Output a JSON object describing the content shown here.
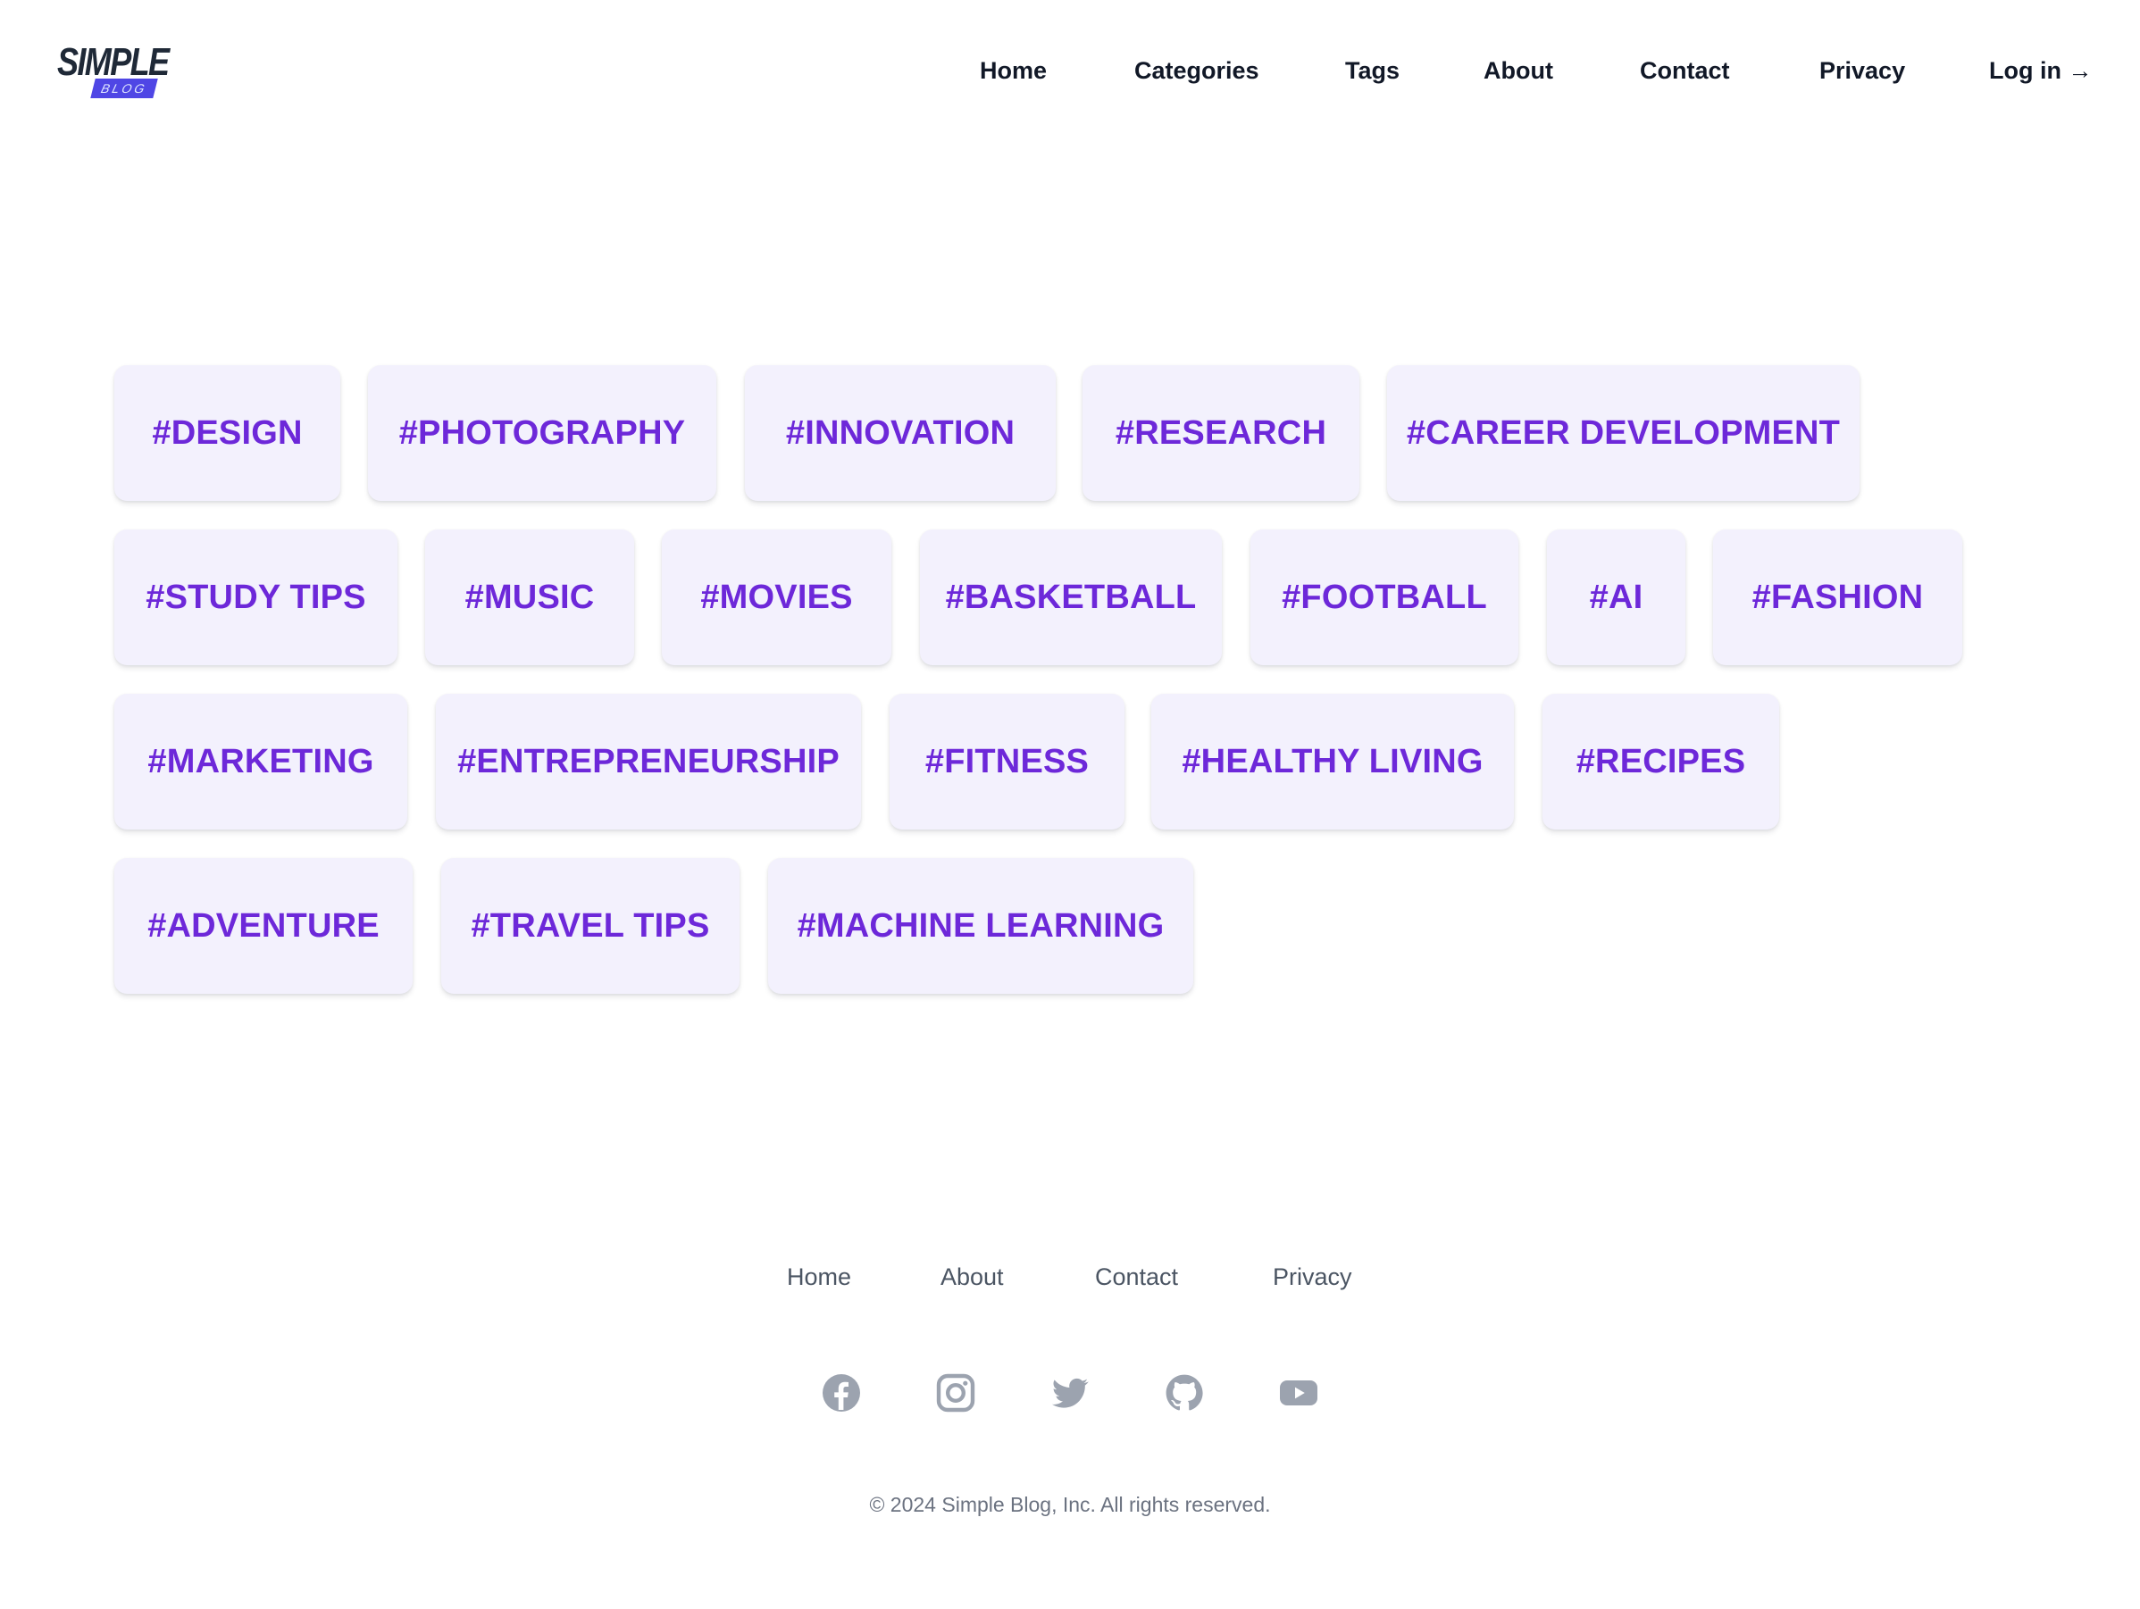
{
  "brand": {
    "logo_top": "SIMPLE",
    "logo_bottom": "BLOG",
    "accent": "#4f46e5"
  },
  "nav": {
    "items": [
      "Home",
      "Categories",
      "Tags",
      "About",
      "Contact",
      "Privacy"
    ],
    "login": "Log in →"
  },
  "tags": [
    "#DESIGN",
    "#PHOTOGRAPHY",
    "#INNOVATION",
    "#RESEARCH",
    "#CAREER DEVELOPMENT",
    "#STUDY TIPS",
    "#MUSIC",
    "#MOVIES",
    "#BASKETBALL",
    "#FOOTBALL",
    "#AI",
    "#FASHION",
    "#MARKETING",
    "#ENTREPRENEURSHIP",
    "#FITNESS",
    "#HEALTHY LIVING",
    "#RECIPES",
    "#ADVENTURE",
    "#TRAVEL TIPS",
    "#MACHINE LEARNING"
  ],
  "tag_colors": {
    "text": "#6d28d9",
    "background": "#f3f1fd"
  },
  "footer": {
    "links": [
      "Home",
      "About",
      "Contact",
      "Privacy"
    ],
    "social": [
      "facebook-icon",
      "instagram-icon",
      "twitter-icon",
      "github-icon",
      "youtube-icon"
    ],
    "copyright": "© 2024 Simple Blog, Inc. All rights reserved."
  }
}
